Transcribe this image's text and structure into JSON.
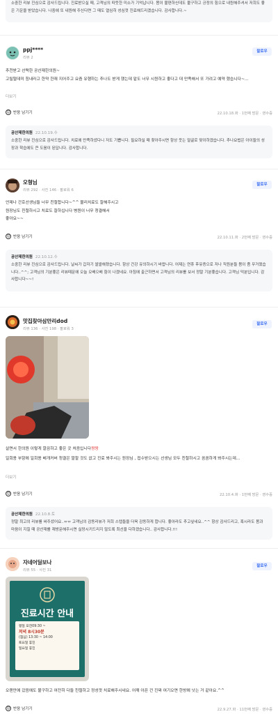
{
  "top_owner_reply": {
    "text": "소중한 리뷰 진심으로 감사드립니다. 진료받으실 때, 고객님의 따뜻한 미소가 기억납니다. 몸이 불편하신데도 불구하고 긍정의 힘으로 내원해주셔서 저희도 좋은 기운을 받았습니다. 나중에 또 내원해 주신다면 그 때도 열심히 성심껏 진료해드리겠습니다. 감사합니다.~"
  },
  "reviews": [
    {
      "user": "ppj****",
      "user_meta": "리뷰 2",
      "follow_label": "팔로우",
      "text": "추천받고 선택한 공산재한의원~\n고릴떨데미 힘내라고 한약 한재 지어주고 요즘 유행하는 추나도 받게 했는데 맡도 너무 시원하고 좋다고 대 만족해서 또 가려고 예약 했습니다~...",
      "more_label": "더보기",
      "react_label": "반응 남기기",
      "date_meta": "22.10.18.화 · 1번째 방문 · 영수증",
      "owner": {
        "name": "공산재한의원",
        "date": "22.10.19.수",
        "text": "소중한 리뷰 진심으로 감사드립니다. 치료에 만족하셨다니 저도 기쁩니다. 필요하실 때 찾아주시면 항상 웃는 얼굴로 맞이하겠습니다. 추나요법은 아이들의 성장과 학습에도 큰 도움이 된답니다. 감사합니다."
      }
    },
    {
      "user": "오형님",
      "user_meta": "리뷰 292 · 사진 146 · 팔로워 6",
      "follow_label": "팔로우",
      "text": "언제나 간호선생님들 너무 친절합니다~^^ 물리치료도 잘해주시고\n원장님도 친절하시고 치료도 잘하십니다 병원이 너무 청결해서\n좋아요~~",
      "react_label": "반응 남기기",
      "date_meta": "22.10.11.화 · 2번째 방문 · 영수증",
      "owner": {
        "name": "공산재한의원",
        "date": "22.10.12.수",
        "text": "소중한 리뷰 진심으로 감사드립니다. 날씨가 갑자기 쌀쌀해졌습니다. 항상 건강 유의하시기 바랍니다. 어제는 연휴 후유증으로 저나 직원분들 몸이 좀 무거웠습니다..^^; 고객님의 기분좋은 리뷰때문에 오늘 오배으배 힘이 나겠네요. 아침에 출근하면서 고객님의 리뷰를 보서 정말 기분좋습니다. 고객님 덕분입니다. 감사합니다~~!"
      }
    },
    {
      "user": "맛집찾아삼만리dod",
      "user_meta": "리뷰 136 · 사진 198 · 팔로워 3",
      "follow_label": "팔로우",
      "text_a": "살면서 한의원 이렇게 깔끔하고 좋은 곳 처음입니다",
      "text_emoji": "짱짱",
      "text_b": "일회용 부항에 일회용 베개커버 청결은 말할 것도 없고 진료 봐주시는 원장님 , 접수받으시는 선생님 모두 친절하시고 꼼꼼하게 봐주시는데...",
      "more_label": "더보기",
      "react_label": "반응 남기기",
      "date_meta": "22.10.4.화 · 1번째 방문 · 영수증",
      "owner": {
        "name": "공산재한의원",
        "date": "22.10.8.토",
        "text": "정말 최고의 리뷰를 써주셨어요..ㅠㅠ 고객님의 감동리뷰가 저희 스텝들을 더욱 감동하게 합니다. 좋아라도 추고싶네요..^^ 항상 감사드리고, 혹시라도 몸과 마음이 지칠 때 공산재를 재방문해주시면 실망시키드리지 않도록 최선을 다하겠습니다.. 감사합니다.!!!"
      }
    },
    {
      "user": "자네어딜보나",
      "user_meta": "리뷰 55 · 사진 31",
      "follow_label": "팔로우",
      "photo_sign": {
        "title": "진료시간 안내",
        "line1": "평일 오전09:30 ~",
        "line2": "저녁 8시30분",
        "line3": "(점심) 13:30 ~ 14:00",
        "line4": "토요일 휴진",
        "line5": "일요일 휴진"
      },
      "text": "오랜만에 갔음에도 불구하고 여전히 다들 친절하고 정성껏 치료해주시네요. 어깨 아픈 건 진짜 여기오면 한방에 낫는 거 같아요.^^",
      "react_label": "반응 남기기",
      "date_meta": "22.9.27.화 · 11번째 방문 · 영수증"
    }
  ],
  "colors": {
    "accent": "#3a6df0",
    "owner_bg": "#f6f7f9"
  }
}
